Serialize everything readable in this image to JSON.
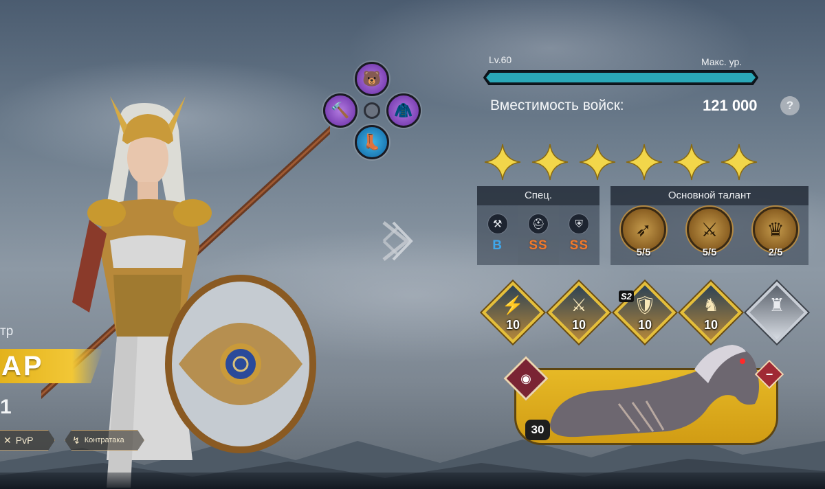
{
  "hero": {
    "title_partial": "тр",
    "name_partial": "АР",
    "number_partial": "1",
    "tags": [
      {
        "icon": "crossed-swords-icon",
        "label": "PvP"
      },
      {
        "icon": "counter-icon",
        "label": "Контратака"
      }
    ]
  },
  "equipment": {
    "slots": [
      {
        "name": "helmet",
        "rarity": "purple",
        "icon": "bear-helmet-icon"
      },
      {
        "name": "weapon",
        "rarity": "purple",
        "icon": "hammer-icon"
      },
      {
        "name": "armor",
        "rarity": "purple",
        "icon": "hood-armor-icon"
      },
      {
        "name": "boots",
        "rarity": "blue",
        "icon": "boots-icon"
      }
    ]
  },
  "level": {
    "current_label": "Lv.60",
    "max_label": "Макс. ур.",
    "progress_percent": 100,
    "bar_color": "#2aa8b8"
  },
  "capacity": {
    "label": "Вместимость войск:",
    "value": "121 000",
    "help": "?"
  },
  "stars": {
    "count": 6,
    "color": "#f2d64a"
  },
  "spec": {
    "title": "Спец.",
    "items": [
      {
        "icon": "pickaxe-icon",
        "grade": "B"
      },
      {
        "icon": "helmet-icon",
        "grade": "SS"
      },
      {
        "icon": "shield-icon",
        "grade": "SS"
      }
    ]
  },
  "talent": {
    "title": "Основной талант",
    "items": [
      {
        "icon": "arrows-icon",
        "count": "5/5"
      },
      {
        "icon": "sword-icon",
        "count": "5/5"
      },
      {
        "icon": "crown-icon",
        "count": "2/5"
      }
    ]
  },
  "skills": [
    {
      "icon": "spear-strike-icon",
      "level": "10"
    },
    {
      "icon": "warrior-icon",
      "level": "10"
    },
    {
      "icon": "soldier-icon",
      "level": "10",
      "badge": "S2"
    },
    {
      "icon": "knight-icon",
      "level": "10"
    },
    {
      "icon": "locked-knight-icon",
      "level": ""
    }
  ],
  "mount": {
    "name": "horse",
    "level": "30",
    "badge_icon": "eye-icon",
    "remove_icon": "minus-icon"
  },
  "colors": {
    "gold": "#e5bf3a",
    "grade_b": "#3fa7ec",
    "grade_ss": "#f27a2b"
  }
}
